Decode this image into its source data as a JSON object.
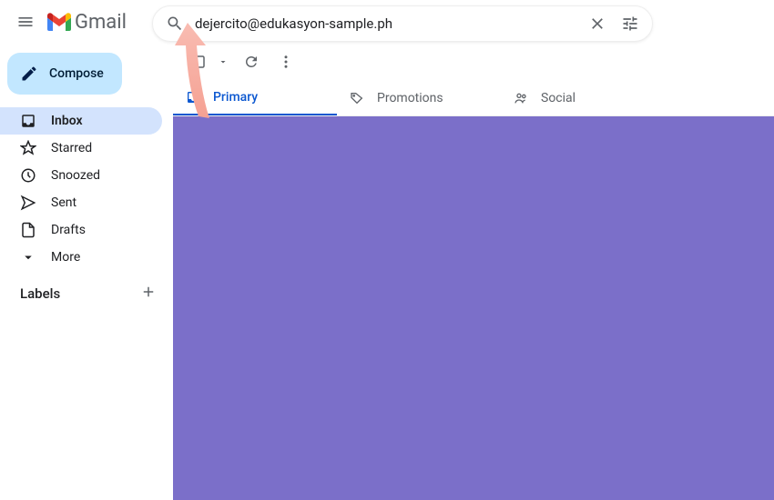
{
  "header": {
    "app_name": "Gmail",
    "search_value": "dejercito@edukasyon-sample.ph"
  },
  "sidebar": {
    "compose_label": "Compose",
    "nav": [
      {
        "label": "Inbox"
      },
      {
        "label": "Starred"
      },
      {
        "label": "Snoozed"
      },
      {
        "label": "Sent"
      },
      {
        "label": "Drafts"
      },
      {
        "label": "More"
      }
    ],
    "labels_title": "Labels"
  },
  "tabs": [
    {
      "label": "Primary"
    },
    {
      "label": "Promotions"
    },
    {
      "label": "Social"
    }
  ]
}
